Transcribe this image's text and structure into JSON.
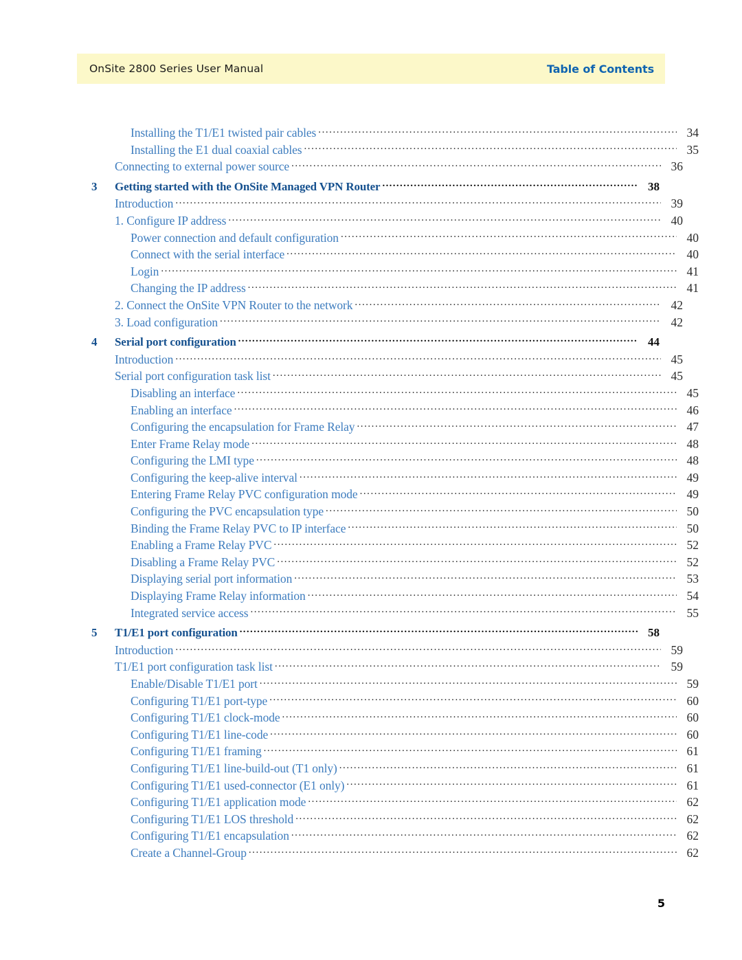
{
  "header": {
    "manual_title": "OnSite 2800 Series User Manual",
    "section_label": "Table of Contents",
    "band_color": "#fcf8c9",
    "accent_color": "#1064b0"
  },
  "folio": {
    "page_number": "5"
  },
  "toc": {
    "entries": [
      {
        "level": 2,
        "chapter": "",
        "title": "Installing the T1/E1 twisted pair cables",
        "page": "34",
        "is_chapter": false
      },
      {
        "level": 2,
        "chapter": "",
        "title": "Installing the E1 dual coaxial cables",
        "page": "35",
        "is_chapter": false
      },
      {
        "level": 1,
        "chapter": "",
        "title": "Connecting to external power source",
        "page": "36",
        "is_chapter": false
      },
      {
        "level": 0,
        "chapter": "3",
        "title": "Getting started with the OnSite Managed VPN Router",
        "page": "38",
        "is_chapter": true
      },
      {
        "level": 1,
        "chapter": "",
        "title": "Introduction",
        "page": "39",
        "is_chapter": false
      },
      {
        "level": 1,
        "chapter": "",
        "title": "1. Configure IP address",
        "page": "40",
        "is_chapter": false
      },
      {
        "level": 2,
        "chapter": "",
        "title": "Power connection and default configuration",
        "page": "40",
        "is_chapter": false
      },
      {
        "level": 2,
        "chapter": "",
        "title": "Connect with the serial interface",
        "page": "40",
        "is_chapter": false
      },
      {
        "level": 2,
        "chapter": "",
        "title": "Login",
        "page": "41",
        "is_chapter": false
      },
      {
        "level": 2,
        "chapter": "",
        "title": "Changing the IP address",
        "page": "41",
        "is_chapter": false
      },
      {
        "level": 1,
        "chapter": "",
        "title": "2. Connect the OnSite VPN Router to the network",
        "page": "42",
        "is_chapter": false
      },
      {
        "level": 1,
        "chapter": "",
        "title": "3. Load configuration",
        "page": "42",
        "is_chapter": false
      },
      {
        "level": 0,
        "chapter": "4",
        "title": "Serial port configuration",
        "page": "44",
        "is_chapter": true
      },
      {
        "level": 1,
        "chapter": "",
        "title": "Introduction",
        "page": "45",
        "is_chapter": false
      },
      {
        "level": 1,
        "chapter": "",
        "title": "Serial port configuration task list",
        "page": "45",
        "is_chapter": false
      },
      {
        "level": 2,
        "chapter": "",
        "title": "Disabling an interface",
        "page": "45",
        "is_chapter": false
      },
      {
        "level": 2,
        "chapter": "",
        "title": "Enabling an interface",
        "page": "46",
        "is_chapter": false
      },
      {
        "level": 2,
        "chapter": "",
        "title": "Configuring the encapsulation for Frame Relay",
        "page": "47",
        "is_chapter": false
      },
      {
        "level": 2,
        "chapter": "",
        "title": "Enter Frame Relay mode",
        "page": "48",
        "is_chapter": false
      },
      {
        "level": 2,
        "chapter": "",
        "title": "Configuring the LMI type",
        "page": "48",
        "is_chapter": false
      },
      {
        "level": 2,
        "chapter": "",
        "title": "Configuring the keep-alive interval",
        "page": "49",
        "is_chapter": false
      },
      {
        "level": 2,
        "chapter": "",
        "title": "Entering Frame Relay PVC configuration mode",
        "page": "49",
        "is_chapter": false
      },
      {
        "level": 2,
        "chapter": "",
        "title": "Configuring the PVC encapsulation type",
        "page": "50",
        "is_chapter": false
      },
      {
        "level": 2,
        "chapter": "",
        "title": "Binding the Frame Relay PVC to IP interface",
        "page": "50",
        "is_chapter": false
      },
      {
        "level": 2,
        "chapter": "",
        "title": "Enabling a Frame Relay PVC",
        "page": "52",
        "is_chapter": false
      },
      {
        "level": 2,
        "chapter": "",
        "title": "Disabling a Frame Relay PVC",
        "page": "52",
        "is_chapter": false
      },
      {
        "level": 2,
        "chapter": "",
        "title": "Displaying serial port information",
        "page": "53",
        "is_chapter": false
      },
      {
        "level": 2,
        "chapter": "",
        "title": "Displaying Frame Relay information",
        "page": "54",
        "is_chapter": false
      },
      {
        "level": 2,
        "chapter": "",
        "title": "Integrated service access",
        "page": "55",
        "is_chapter": false
      },
      {
        "level": 0,
        "chapter": "5",
        "title": "T1/E1 port configuration",
        "page": "58",
        "is_chapter": true
      },
      {
        "level": 1,
        "chapter": "",
        "title": "Introduction",
        "page": "59",
        "is_chapter": false
      },
      {
        "level": 1,
        "chapter": "",
        "title": "T1/E1 port configuration task list",
        "page": "59",
        "is_chapter": false
      },
      {
        "level": 2,
        "chapter": "",
        "title": "Enable/Disable T1/E1 port",
        "page": "59",
        "is_chapter": false
      },
      {
        "level": 2,
        "chapter": "",
        "title": "Configuring T1/E1 port-type",
        "page": "60",
        "is_chapter": false
      },
      {
        "level": 2,
        "chapter": "",
        "title": "Configuring T1/E1 clock-mode",
        "page": "60",
        "is_chapter": false
      },
      {
        "level": 2,
        "chapter": "",
        "title": "Configuring T1/E1 line-code",
        "page": "60",
        "is_chapter": false
      },
      {
        "level": 2,
        "chapter": "",
        "title": "Configuring T1/E1 framing",
        "page": "61",
        "is_chapter": false
      },
      {
        "level": 2,
        "chapter": "",
        "title": "Configuring T1/E1 line-build-out (T1 only)",
        "page": "61",
        "is_chapter": false
      },
      {
        "level": 2,
        "chapter": "",
        "title": "Configuring T1/E1 used-connector (E1 only)",
        "page": "61",
        "is_chapter": false
      },
      {
        "level": 2,
        "chapter": "",
        "title": "Configuring T1/E1 application mode",
        "page": "62",
        "is_chapter": false
      },
      {
        "level": 2,
        "chapter": "",
        "title": "Configuring T1/E1 LOS threshold",
        "page": "62",
        "is_chapter": false
      },
      {
        "level": 2,
        "chapter": "",
        "title": "Configuring T1/E1 encapsulation",
        "page": "62",
        "is_chapter": false
      },
      {
        "level": 2,
        "chapter": "",
        "title": "Create a Channel-Group",
        "page": "62",
        "is_chapter": false
      }
    ]
  }
}
